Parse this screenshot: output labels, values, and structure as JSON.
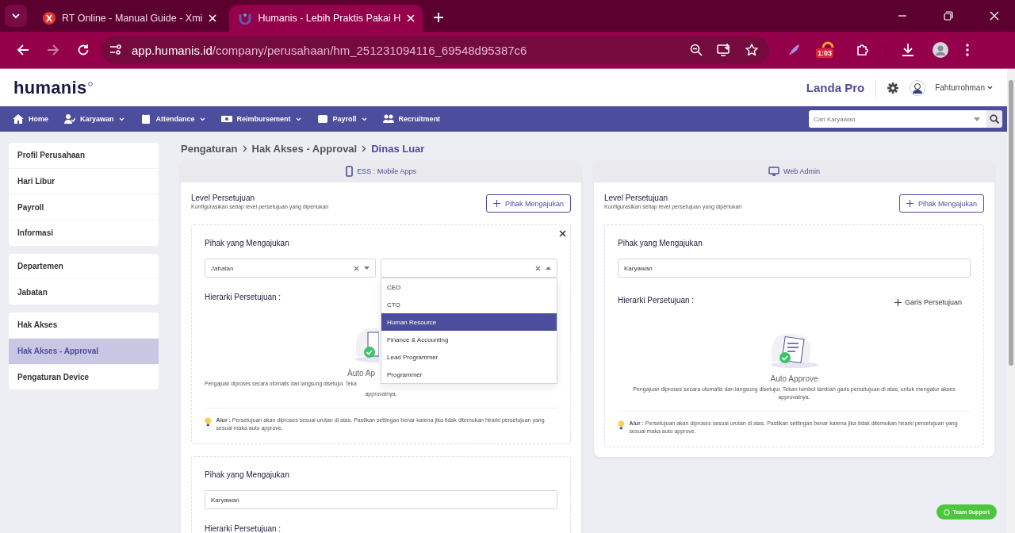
{
  "browser": {
    "tabs": [
      {
        "title": "RT Online - Manual Guide - Xmi",
        "selected": false
      },
      {
        "title": "Humanis - Lebih Praktis Pakai H",
        "selected": true
      }
    ],
    "url_host": "app.humanis.id",
    "url_path": "/company/perusahaan/hm_251231094116_69548d95387c6",
    "extension_badge": "1:03"
  },
  "header": {
    "logo": "humanis",
    "company": "Landa Pro",
    "user": "Fahturrohman"
  },
  "nav": {
    "items": [
      {
        "label": "Home",
        "has_menu": false
      },
      {
        "label": "Karyawan",
        "has_menu": true
      },
      {
        "label": "Attendance",
        "has_menu": true
      },
      {
        "label": "Reimbursement",
        "has_menu": true
      },
      {
        "label": "Payroll",
        "has_menu": true
      },
      {
        "label": "Recruitment",
        "has_menu": false
      }
    ],
    "search": {
      "placeholder": "Cari Karyawan"
    }
  },
  "sidebar": {
    "groups": [
      {
        "items": [
          {
            "label": "Profil Perusahaan",
            "selected": false
          },
          {
            "label": "Hari Libur",
            "selected": false
          },
          {
            "label": "Payroll",
            "selected": false
          },
          {
            "label": "Informasi",
            "selected": false
          }
        ]
      },
      {
        "items": [
          {
            "label": "Departemen",
            "selected": false
          },
          {
            "label": "Jabatan",
            "selected": false
          }
        ]
      },
      {
        "items": [
          {
            "label": "Hak Akses",
            "selected": false
          },
          {
            "label": "Hak Akses - Approval",
            "selected": true
          },
          {
            "label": "Pengaturan Device",
            "selected": false
          }
        ]
      }
    ]
  },
  "breadcrumb": [
    "Pengaturan",
    "Hak Akses - Approval",
    "Dinas Luar"
  ],
  "panels": [
    {
      "header": "ESS : Mobile Apps",
      "kind": "mobile",
      "title": "Level Persetujuan",
      "subtitle": "Konfigurasikan setiap level persetujuan yang diperlukan",
      "add_button": "Pihak Mengajukan",
      "cards": [
        {
          "closable": true,
          "heading": "Pihak yang Mengajukan",
          "selects": [
            {
              "value": "Jabatan",
              "open": false
            },
            {
              "open": true,
              "options": [
                {
                  "label": "CEO",
                  "selected": false
                },
                {
                  "label": "CTO",
                  "selected": false
                },
                {
                  "label": "Human Resource",
                  "selected": true
                },
                {
                  "label": "Finance & Accounting",
                  "selected": false
                },
                {
                  "label": "Lead Programmer",
                  "selected": false
                },
                {
                  "label": "Programmer",
                  "selected": false
                }
              ]
            }
          ],
          "hierarchy_label": "Hierarki Persetujuan :",
          "empty_title": "Auto Ap",
          "empty_desc": [
            "Pengajuan diproses secara otomatis dan langsung disetujui. Teka",
            "approvalnya."
          ],
          "tip": "**Alur :** Persetujuan akan diproses sesuai urutan di atas. Pastikan settingan benar karena jika tidak ditemukan hirarki persetujuan yang sesuai maka auto approve."
        },
        {
          "closable": false,
          "heading": "Pihak yang Mengajukan",
          "field": "Karyawan",
          "hierarchy_label": "Hierarki Persetujuan :"
        }
      ]
    },
    {
      "header": "Web Admin",
      "kind": "desktop",
      "title": "Level Persetujuan",
      "subtitle": "Konfigurasikan setiap level persetujuan yang diperlukan",
      "add_button": "Pihak Mengajukan",
      "cards": [
        {
          "closable": false,
          "heading": "Pihak yang Mengajukan",
          "field": "Karyawan",
          "hierarchy_label": "Hierarki Persetujuan :",
          "add_line": "Garis Persetujuan",
          "empty_title": "Auto Approve",
          "empty_desc": [
            "Pengajuan diproses secara otomatis dan langsung disetujui. Tekan tombol tambah garis persetujuan di atas, untuk mengatur akses approvalnya."
          ],
          "tip": "**Alur :** Persetujuan akan diproses sesuai urutan di atas. Pastikan settingan benar karena jika tidak ditemukan hirarki persetujuan yang sesuai maka auto approve."
        }
      ]
    }
  ],
  "support_button": "Team Support"
}
